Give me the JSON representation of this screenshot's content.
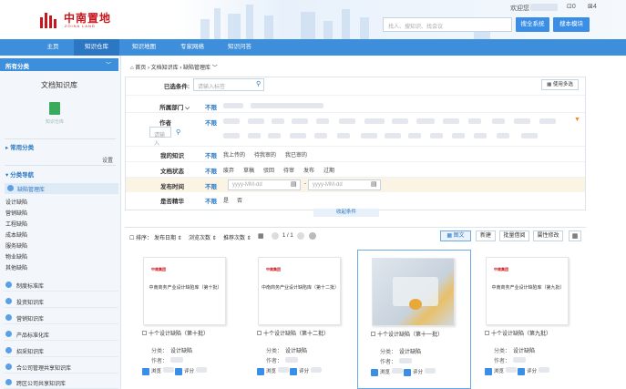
{
  "header": {
    "logo_text": "中南置地",
    "logo_sub": "ZOINA LAND",
    "welcome": "欢迎您",
    "msg_count": "0",
    "notice_count": "4",
    "search_placeholder": "找人、搜知识、找会议",
    "search_btn": "搜全系统",
    "module_btn": "搜本模块"
  },
  "nav": [
    "主页",
    "知识仓库",
    "知识地图",
    "专家网络",
    "知识问答"
  ],
  "sidebar": {
    "title": "所有分类",
    "doc_lib": "文档知识库",
    "doc_lib_sub": "知识仓库",
    "common_section": "常用分类",
    "setting": "设置",
    "nav_section": "分类导航",
    "active_item": "缺陷管理库",
    "items": [
      "设计缺陷",
      "营销缺陷",
      "工程缺陷",
      "成本缺陷",
      "服务缺陷",
      "物业缺陷",
      "其他缺陷"
    ],
    "categories": [
      "制度标准库",
      "投资知识库",
      "营销知识库",
      "产品标准化库",
      "招采知识库",
      "合公司管理共享知识库",
      "跨区公司共享知识库"
    ]
  },
  "breadcrumb": [
    "首页",
    "文档知识库",
    "缺陷管理库"
  ],
  "filter": {
    "selected_label": "已选条件:",
    "selected_placeholder": "请输入标签",
    "multi_select": "使用多选",
    "dept_label": "所属部门",
    "author_label": "作者",
    "author_input": "请输入",
    "buxian": "不限",
    "knowledge_label": "我的知识",
    "knowledge_opts": [
      "我上传的",
      "待我审的",
      "我已审的"
    ],
    "status_label": "文档状态",
    "status_opts": [
      "废弃",
      "草稿",
      "驳回",
      "待审",
      "发布",
      "过期"
    ],
    "publish_label": "发布时间",
    "date_from": "yyyy-MM-dd",
    "date_to": "yyyy-MM-dd",
    "excellent_label": "是否精华",
    "excellent_opts": [
      "是",
      "否"
    ],
    "collapse": "收起条件"
  },
  "toolbar": {
    "sort_label": "排序：",
    "sort_opts": [
      "发布日期",
      "浏览次数",
      "推荐次数"
    ],
    "page": "1 / 1",
    "view_btn": "图文",
    "new_btn": "新建",
    "batch_btn": "批量借阅",
    "attr_btn": "属性修改"
  },
  "cards": [
    {
      "brand": "中南集团",
      "doc_title": "中南商务产业设计缺陷库（第十批）",
      "title": "十个设计缺陷（第十批）",
      "cat_label": "分类：",
      "cat": "设计缺陷",
      "author_label": "作者：",
      "views_label": "浏览",
      "rate_label": "评分",
      "image": "doc"
    },
    {
      "brand": "中南集团",
      "doc_title": "中南商务产业设计缺陷库（第十二批）",
      "title": "十个设计缺陷（第十二批）",
      "cat_label": "分类：",
      "cat": "设计缺陷",
      "author_label": "作者：",
      "views_label": "浏览",
      "rate_label": "评分",
      "image": "doc"
    },
    {
      "brand": "",
      "doc_title": "",
      "title": "十个设计缺陷（第十一批）",
      "cat_label": "分类：",
      "cat": "设计缺陷",
      "author_label": "作者：",
      "views_label": "浏览",
      "rate_label": "评分",
      "image": "photo"
    },
    {
      "brand": "中南集团",
      "doc_title": "中南商务产业设计缺陷库（第九批）",
      "title": "十个设计缺陷（第九批）",
      "cat_label": "分类：",
      "cat": "设计缺陷",
      "author_label": "作者：",
      "views_label": "浏览",
      "rate_label": "评分",
      "image": "doc"
    }
  ],
  "colors": {
    "primary": "#3d8fdc",
    "brand_red": "#c8161d",
    "accent_orange": "#f08c1e"
  }
}
